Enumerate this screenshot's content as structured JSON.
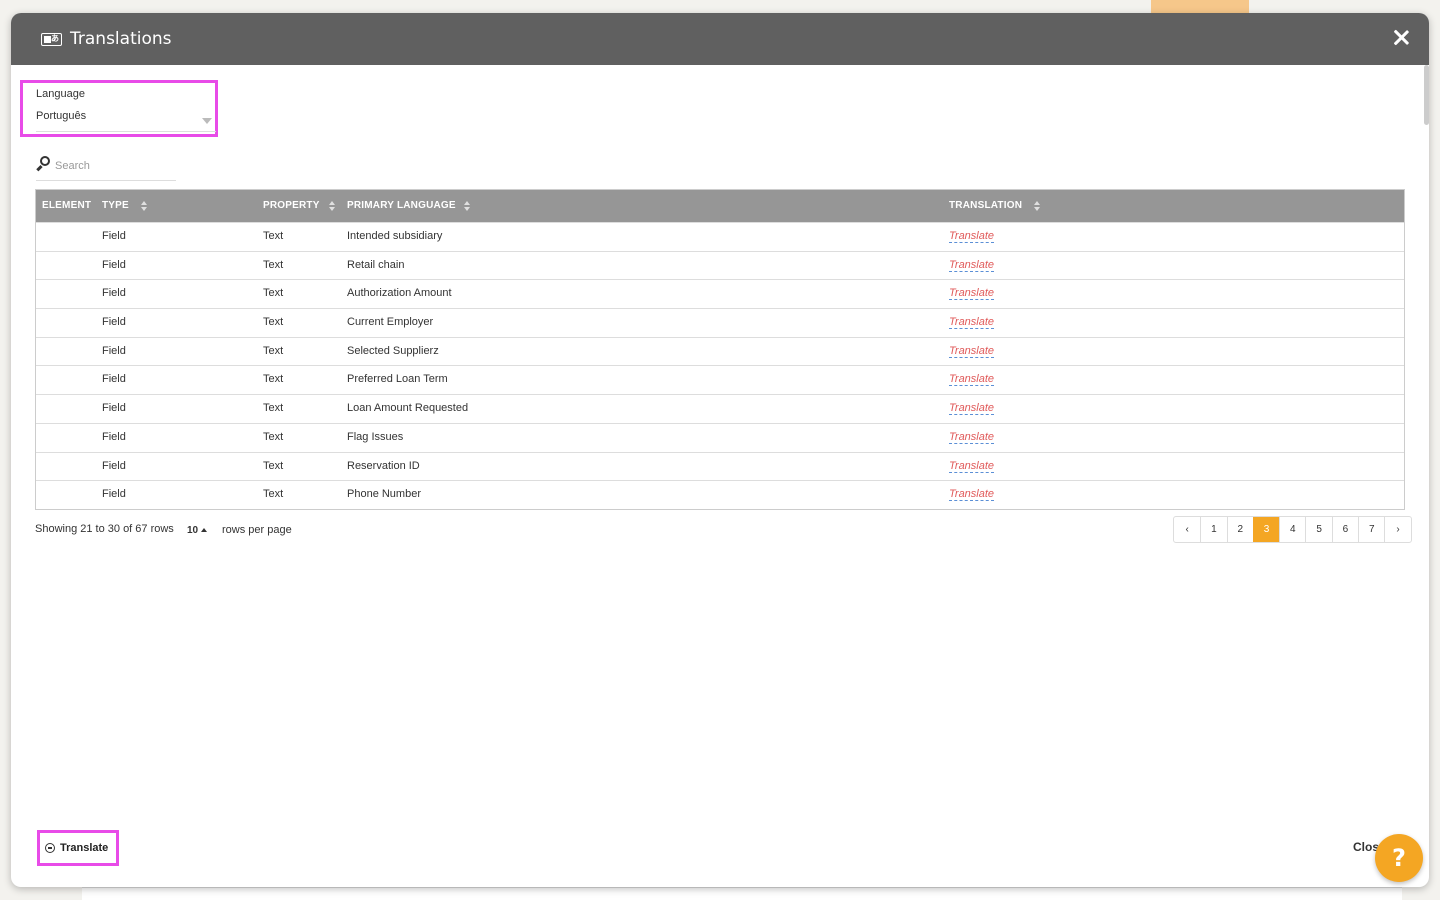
{
  "modal": {
    "title": "Translations",
    "close_glyph": "×"
  },
  "language": {
    "label": "Language",
    "value": "Português"
  },
  "search": {
    "placeholder": "Search"
  },
  "table": {
    "columns": [
      "ELEMENT",
      "TYPE",
      "PROPERTY",
      "PRIMARY LANGUAGE",
      "TRANSLATION"
    ],
    "rows": [
      {
        "element": "",
        "type": "Field",
        "property": "Text",
        "primary": "Intended subsidiary",
        "translation": "Translate"
      },
      {
        "element": "",
        "type": "Field",
        "property": "Text",
        "primary": "Retail chain",
        "translation": "Translate"
      },
      {
        "element": "",
        "type": "Field",
        "property": "Text",
        "primary": "Authorization Amount",
        "translation": "Translate"
      },
      {
        "element": "",
        "type": "Field",
        "property": "Text",
        "primary": "Current Employer",
        "translation": "Translate"
      },
      {
        "element": "",
        "type": "Field",
        "property": "Text",
        "primary": "Selected Supplierz",
        "translation": "Translate"
      },
      {
        "element": "",
        "type": "Field",
        "property": "Text",
        "primary": "Preferred Loan Term",
        "translation": "Translate"
      },
      {
        "element": "",
        "type": "Field",
        "property": "Text",
        "primary": "Loan Amount Requested",
        "translation": "Translate"
      },
      {
        "element": "",
        "type": "Field",
        "property": "Text",
        "primary": "Flag Issues",
        "translation": "Translate"
      },
      {
        "element": "",
        "type": "Field",
        "property": "Text",
        "primary": "Reservation ID",
        "translation": "Translate"
      },
      {
        "element": "",
        "type": "Field",
        "property": "Text",
        "primary": "Phone Number",
        "translation": "Translate"
      }
    ]
  },
  "pagination": {
    "info": "Showing 21 to 30 of 67 rows",
    "page_size": "10",
    "rows_per_page_label": "rows per page",
    "prev": "‹",
    "next": "›",
    "pages": [
      "1",
      "2",
      "3",
      "4",
      "5",
      "6",
      "7"
    ],
    "current_page": "3"
  },
  "footer": {
    "translate_label": "Translate",
    "close_label": "Clos"
  },
  "help": {
    "label": "?"
  },
  "icons": {
    "header": "translation-icon",
    "search": "search-icon",
    "translate_button": "translate-icon",
    "close": "close-icon",
    "help": "help-icon"
  },
  "colors": {
    "header_bg": "#606060",
    "table_header_bg": "#969696",
    "accent": "#f4a623",
    "translate_link": "#e05a5a",
    "highlight_box": "#e84be8"
  }
}
